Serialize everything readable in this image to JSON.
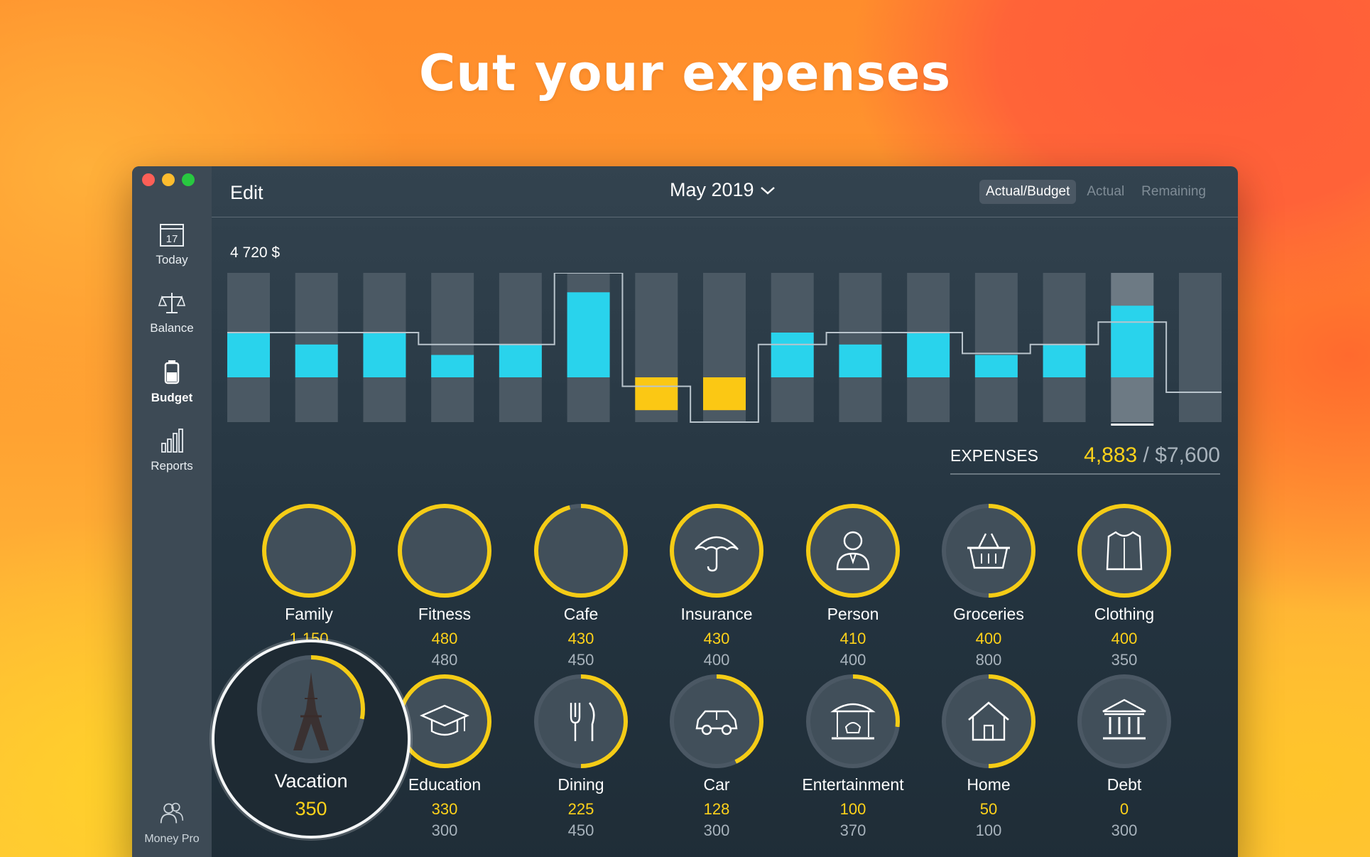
{
  "headline": "Cut your expenses",
  "sidebar": {
    "items": [
      {
        "label": "Today",
        "icon": "calendar-icon",
        "day": "17"
      },
      {
        "label": "Balance",
        "icon": "scales-icon"
      },
      {
        "label": "Budget",
        "icon": "battery-icon"
      },
      {
        "label": "Reports",
        "icon": "bar-chart-icon"
      }
    ],
    "app_name": "Money Pro"
  },
  "toolbar": {
    "edit": "Edit",
    "month": "May 2019",
    "segments": [
      "Actual/Budget",
      "Actual",
      "Remaining"
    ]
  },
  "chart_data": {
    "type": "bar",
    "title": "4 720 $",
    "bars": 15,
    "fills": [
      {
        "from": 0.6,
        "to": 0.3,
        "color": "cyan"
      },
      {
        "from": 0.52,
        "to": 0.3,
        "color": "cyan"
      },
      {
        "from": 0.6,
        "to": 0.3,
        "color": "cyan"
      },
      {
        "from": 0.45,
        "to": 0.3,
        "color": "cyan"
      },
      {
        "from": 0.52,
        "to": 0.3,
        "color": "cyan"
      },
      {
        "from": 0.87,
        "to": 0.3,
        "color": "cyan"
      },
      {
        "from": 0.3,
        "to": 0.08,
        "color": "yellow"
      },
      {
        "from": 0.3,
        "to": 0.08,
        "color": "yellow"
      },
      {
        "from": 0.6,
        "to": 0.3,
        "color": "cyan"
      },
      {
        "from": 0.52,
        "to": 0.3,
        "color": "cyan"
      },
      {
        "from": 0.6,
        "to": 0.3,
        "color": "cyan"
      },
      {
        "from": 0.45,
        "to": 0.3,
        "color": "cyan"
      },
      {
        "from": 0.52,
        "to": 0.3,
        "color": "cyan"
      },
      {
        "from": 0.78,
        "to": 0.3,
        "color": "cyan"
      },
      {
        "from": 0.3,
        "to": 0.3,
        "color": "cyan"
      }
    ],
    "budget_line": [
      0.6,
      0.6,
      0.6,
      0.52,
      0.52,
      1.0,
      0.24,
      0.0,
      0.52,
      0.6,
      0.6,
      0.46,
      0.52,
      0.67,
      0.2
    ],
    "selected_index": 13,
    "colors": {
      "cyan": "#29d3ec",
      "yellow": "#fbc814",
      "bar_bg": "#4b5964",
      "line": "#b9c4cc"
    }
  },
  "expenses": {
    "label": "EXPENSES",
    "actual": "4,883",
    "separator": " / ",
    "budget": "$7,600"
  },
  "categories": [
    {
      "name": "Family",
      "actual": "1 150",
      "budget": "",
      "icon": "family-photo",
      "progress": 100
    },
    {
      "name": "Fitness",
      "actual": "480",
      "budget": "480",
      "icon": "fitness-photo",
      "progress": 100
    },
    {
      "name": "Cafe",
      "actual": "430",
      "budget": "450",
      "icon": "cafe-photo",
      "progress": 96
    },
    {
      "name": "Insurance",
      "actual": "430",
      "budget": "400",
      "icon": "umbrella-icon",
      "progress": 100
    },
    {
      "name": "Person",
      "actual": "410",
      "budget": "400",
      "icon": "person-icon",
      "progress": 100
    },
    {
      "name": "Groceries",
      "actual": "400",
      "budget": "800",
      "icon": "basket-icon",
      "progress": 50
    },
    {
      "name": "Clothing",
      "actual": "400",
      "budget": "350",
      "icon": "shirt-icon",
      "progress": 100
    },
    {
      "name": "Education",
      "actual": "330",
      "budget": "300",
      "icon": "graduation-cap-icon",
      "progress": 100
    },
    {
      "name": "Dining",
      "actual": "225",
      "budget": "450",
      "icon": "fork-knife-icon",
      "progress": 50
    },
    {
      "name": "Car",
      "actual": "128",
      "budget": "300",
      "icon": "car-icon",
      "progress": 43
    },
    {
      "name": "Entertainment",
      "actual": "100",
      "budget": "370",
      "icon": "carousel-icon",
      "progress": 27
    },
    {
      "name": "Home",
      "actual": "50",
      "budget": "100",
      "icon": "home-icon",
      "progress": 50
    },
    {
      "name": "Debt",
      "actual": "0",
      "budget": "300",
      "icon": "bank-icon",
      "progress": 0
    }
  ],
  "spotlight": {
    "name": "Vacation",
    "actual": "350",
    "icon": "eiffel-photo",
    "progress": 28
  }
}
